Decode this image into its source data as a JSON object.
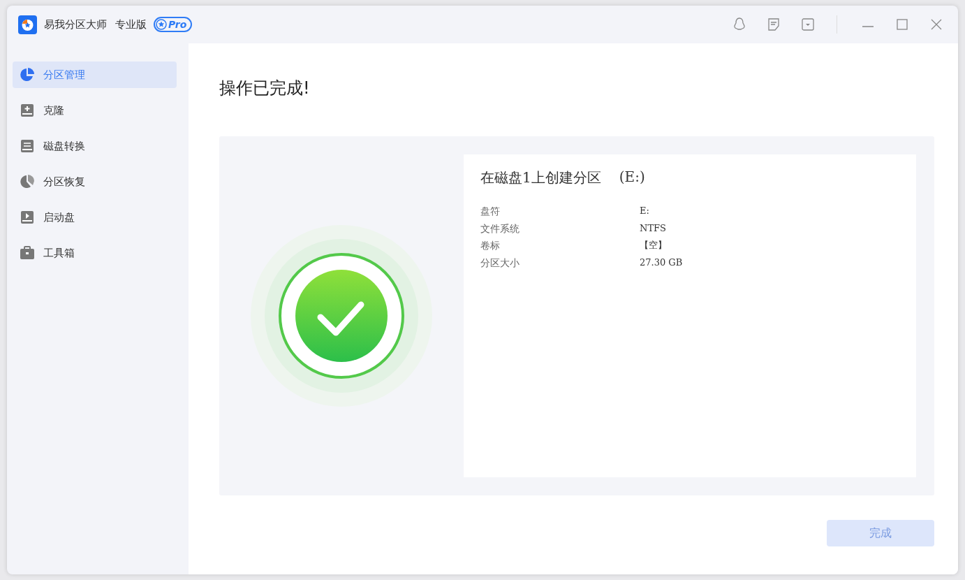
{
  "window": {
    "title": "易我分区大师",
    "edition": "专业版",
    "badge": "Pro"
  },
  "sidebar": {
    "items": [
      {
        "label": "分区管理",
        "selected": true
      },
      {
        "label": "克隆",
        "selected": false
      },
      {
        "label": "磁盘转换",
        "selected": false
      },
      {
        "label": "分区恢复",
        "selected": false
      },
      {
        "label": "启动盘",
        "selected": false
      },
      {
        "label": "工具箱",
        "selected": false
      }
    ]
  },
  "heading": "操作已完成!",
  "operation": {
    "title": "在磁盘1上创建分区",
    "drive": "(E:)",
    "details": [
      {
        "label": "盘符",
        "value": "E:"
      },
      {
        "label": "文件系统",
        "value": "NTFS"
      },
      {
        "label": "卷标",
        "value": "【空】"
      },
      {
        "label": "分区大小",
        "value": "27.30 GB"
      }
    ]
  },
  "finish_button": "完成"
}
